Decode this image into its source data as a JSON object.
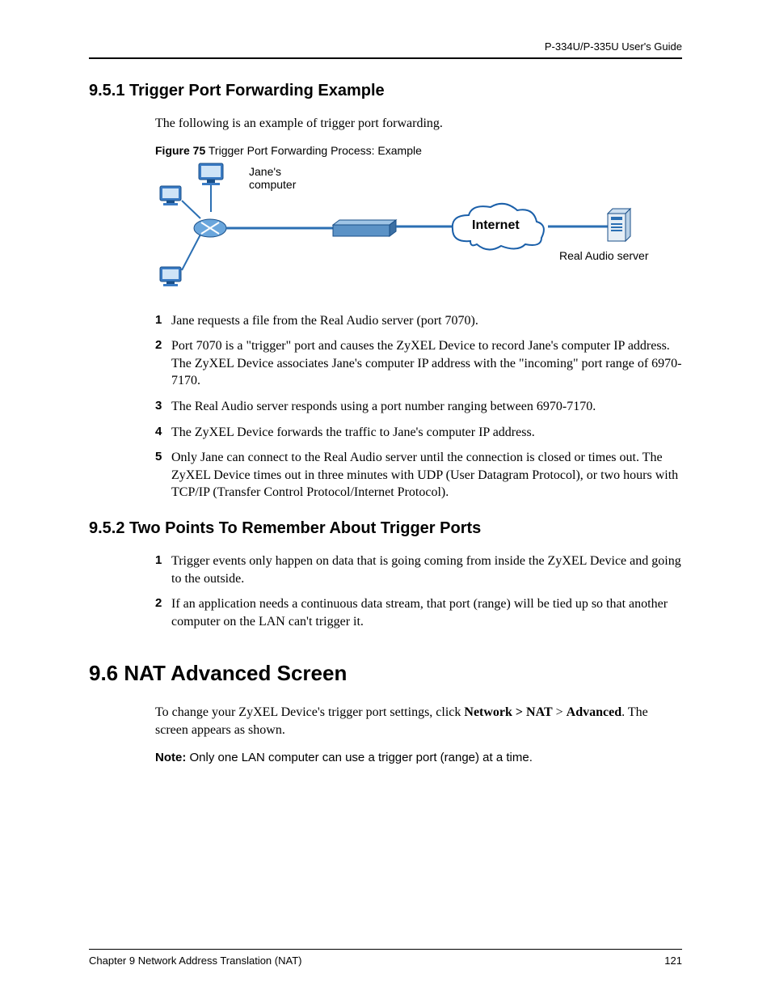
{
  "header": {
    "guide_title": "P-334U/P-335U User's Guide"
  },
  "section_951": {
    "heading": "9.5.1  Trigger Port Forwarding Example",
    "intro": "The following is an example of trigger port forwarding.",
    "figure": {
      "caption_label": "Figure 75",
      "caption_text": "   Trigger Port Forwarding Process: Example",
      "labels": {
        "janes_computer_l1": "Jane's",
        "janes_computer_l2": "computer",
        "internet": "Internet",
        "real_audio_server": "Real Audio server"
      }
    },
    "steps": [
      "Jane requests a file from the Real Audio server (port 7070).",
      "Port 7070 is a \"trigger\" port and causes the ZyXEL Device to record Jane's computer IP address. The ZyXEL Device associates Jane's computer IP address with the \"incoming\" port range of 6970-7170.",
      "The Real Audio server responds using a port number ranging between 6970-7170.",
      "The ZyXEL Device forwards the traffic to Jane's computer IP address.",
      "Only Jane can connect to the Real Audio server until the connection is closed or times out. The ZyXEL Device times out in three minutes with UDP (User Datagram Protocol), or two hours with TCP/IP (Transfer Control Protocol/Internet Protocol)."
    ]
  },
  "section_952": {
    "heading": "9.5.2  Two Points To Remember About Trigger Ports",
    "steps": [
      "Trigger events only happen on data that is going coming from inside the ZyXEL Device and going to the outside.",
      "If an application needs a continuous data stream, that port (range) will be tied up so that another computer on the LAN can't trigger it."
    ]
  },
  "section_96": {
    "heading": "9.6  NAT Advanced Screen",
    "para_pre": "To change your ZyXEL Device's trigger port settings, click ",
    "nav1": "Network > NAT",
    "nav_sep": " > ",
    "nav2": "Advanced",
    "para_post": ". The screen appears as shown.",
    "note_label": "Note:",
    "note_text": " Only one LAN computer can use a trigger port (range) at a time."
  },
  "footer": {
    "chapter": "Chapter 9 Network Address Translation (NAT)",
    "page": "121"
  },
  "colors": {
    "device_blue": "#2b6fb3",
    "cloud_stroke": "#1a5fa9"
  }
}
